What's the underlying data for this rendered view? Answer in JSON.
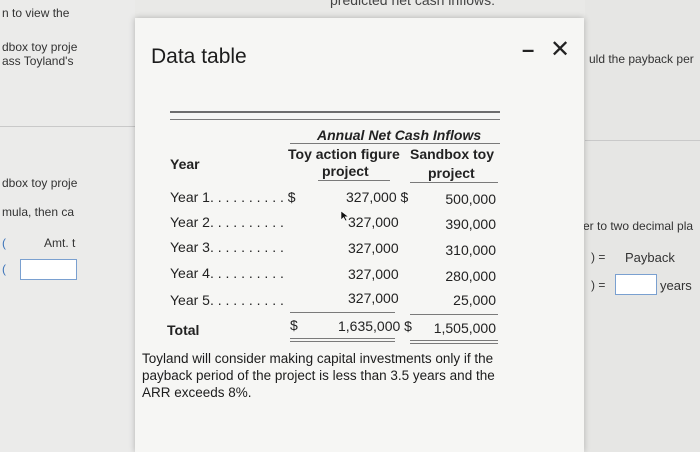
{
  "background": {
    "top_strip": "predicted net cash inflows:",
    "left": {
      "line1": "n to view the",
      "line2": "dbox toy proje",
      "line3": "ass Toyland's",
      "line4": "dbox toy proje",
      "line5": "mula, then ca",
      "amt_label": "Amt. t",
      "paren1": "(",
      "paren2": "("
    },
    "right": {
      "line1": "uld the payback per",
      "line2": "er to two decimal pla",
      "eq1": ") =",
      "payback_label": "Payback",
      "eq2": ") =",
      "years_label": "years"
    }
  },
  "modal": {
    "title": "Data table",
    "minimize_label": "–",
    "close_label": "✕",
    "table": {
      "group_header": "Annual Net Cash Inflows",
      "col1_header_line1": "Toy action figure",
      "col1_header_line2": "project",
      "col2_header_line1": "Sandbox toy",
      "col2_header_line2": "project",
      "year_header": "Year",
      "rows": [
        {
          "label": "Year 1. . . . . . . . . . $",
          "c1": "327,000 $",
          "c2": "500,000"
        },
        {
          "label": "Year 2. . . . . . . . . .",
          "c1": "327,000",
          "c2": "390,000"
        },
        {
          "label": "Year 3. . . . . . . . . .",
          "c1": "327,000",
          "c2": "310,000"
        },
        {
          "label": "Year 4. . . . . . . . . .",
          "c1": "327,000",
          "c2": "280,000"
        },
        {
          "label": "Year 5. . . . . . . . . .",
          "c1": "327,000",
          "c2": "25,000"
        }
      ],
      "total_label": "Total",
      "total_dollar": "$",
      "total_c1": "1,635,000 $",
      "total_c2": "1,505,000"
    },
    "note": "Toyland will consider making capital investments only if the payback period of the project is less than 3.5 years and the ARR exceeds 8%."
  }
}
